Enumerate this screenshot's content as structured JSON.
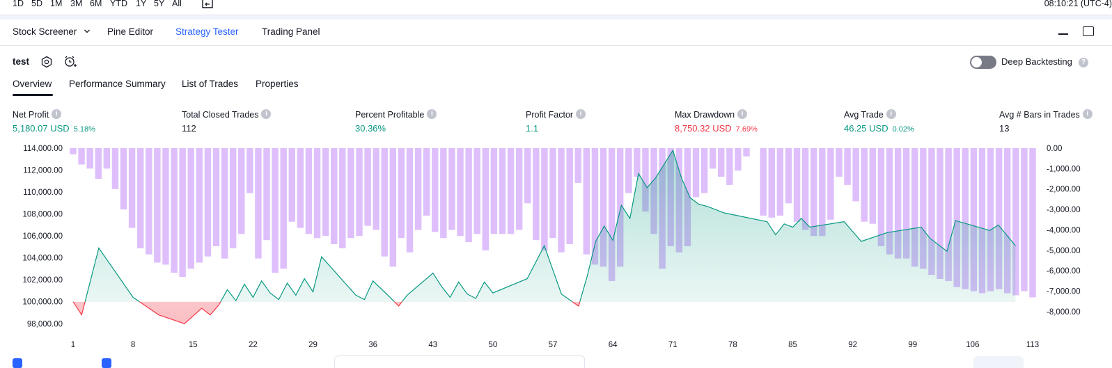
{
  "top_bar": {
    "ranges": [
      "1D",
      "5D",
      "1M",
      "3M",
      "6M",
      "YTD",
      "1Y",
      "5Y",
      "All"
    ],
    "clock": "08:10:21 (UTC-4)"
  },
  "panel_tabs": {
    "stock_screener": "Stock Screener",
    "pine_editor": "Pine Editor",
    "strategy_tester": "Strategy Tester",
    "trading_panel": "Trading Panel"
  },
  "strategy": {
    "name": "test",
    "deep_backtesting_label": "Deep Backtesting",
    "deep_backtesting_enabled": false
  },
  "sub_tabs": [
    "Overview",
    "Performance Summary",
    "List of Trades",
    "Properties"
  ],
  "metrics": [
    {
      "label": "Net Profit",
      "value": "5,180.07 USD",
      "pct": "5.18%",
      "color": "#089981"
    },
    {
      "label": "Total Closed Trades",
      "value": "112",
      "pct": "",
      "color": "#131722"
    },
    {
      "label": "Percent Profitable",
      "value": "30.36%",
      "pct": "",
      "color": "#089981"
    },
    {
      "label": "Profit Factor",
      "value": "1.1",
      "pct": "",
      "color": "#089981"
    },
    {
      "label": "Max Drawdown",
      "value": "8,750.32 USD",
      "pct": "7.69%",
      "color": "#f23645"
    },
    {
      "label": "Avg Trade",
      "value": "46.25 USD",
      "pct": "0.02%",
      "color": "#089981"
    },
    {
      "label": "Avg # Bars in Trades",
      "value": "13",
      "pct": "",
      "color": "#131722"
    }
  ],
  "colors": {
    "equity_up": "#089981",
    "equity_down": "#f23645",
    "drawdown_bar": "#d1a6fa",
    "accent": "#2962ff"
  },
  "chart_data": {
    "type": "line",
    "x_ticks": [
      "1",
      "8",
      "15",
      "22",
      "29",
      "36",
      "43",
      "50",
      "57",
      "64",
      "71",
      "78",
      "85",
      "92",
      "99",
      "106",
      "113"
    ],
    "left_axis": {
      "ticks": [
        "114,000.00",
        "112,000.00",
        "110,000.00",
        "108,000.00",
        "106,000.00",
        "104,000.00",
        "102,000.00",
        "100,000.00",
        "98,000.00"
      ],
      "ylim": [
        97700,
        114000
      ]
    },
    "right_axis": {
      "ticks": [
        "0.00",
        "-1,000.00",
        "-2,000.00",
        "-3,000.00",
        "-4,000.00",
        "-5,000.00",
        "-6,000.00",
        "-7,000.00",
        "-8,000.00"
      ],
      "ylim": [
        -8750,
        0
      ]
    },
    "xlim": [
      1,
      113
    ],
    "baseline": 100000,
    "equity": {
      "x": [
        1,
        2,
        4,
        8,
        11,
        14,
        16,
        17,
        18,
        19,
        20,
        21,
        22,
        23,
        24,
        25,
        26,
        27,
        28,
        29,
        30,
        34,
        35,
        36,
        38,
        39,
        40,
        43,
        44,
        45,
        46,
        47,
        48,
        49,
        50,
        54,
        56,
        58,
        60,
        61,
        62,
        63,
        64,
        65,
        66,
        67,
        68,
        69,
        71,
        72,
        73,
        74,
        75,
        77,
        82,
        83,
        84,
        85,
        86,
        87,
        91,
        93,
        96,
        100,
        101,
        103,
        104,
        108,
        109,
        111
      ],
      "y": [
        100000,
        98800,
        104900,
        100400,
        98800,
        98000,
        99400,
        98800,
        99700,
        101100,
        100100,
        101600,
        100400,
        101900,
        100800,
        100200,
        101700,
        100600,
        102100,
        100900,
        104100,
        100600,
        100200,
        101900,
        100400,
        99600,
        100600,
        102600,
        101400,
        100400,
        101800,
        100700,
        100300,
        101800,
        100800,
        102100,
        105100,
        100700,
        99600,
        102300,
        105500,
        106900,
        105600,
        108800,
        107600,
        111700,
        110400,
        111300,
        113800,
        111300,
        109500,
        108900,
        108700,
        108100,
        107300,
        106100,
        107100,
        106800,
        107600,
        106800,
        107300,
        105500,
        106300,
        106800,
        105800,
        104600,
        107400,
        106500,
        107000,
        105100,
        104800
      ]
    },
    "drawdown": [
      -300,
      -800,
      -1000,
      -1500,
      -1000,
      -2000,
      -3000,
      -3900,
      -4900,
      -5200,
      -5600,
      -5700,
      -6100,
      -6300,
      -5900,
      -5600,
      -5300,
      -4800,
      -5400,
      -4900,
      -4200,
      -2200,
      -5400,
      -4500,
      -6100,
      -5900,
      -3600,
      -3900,
      -4200,
      -4400,
      -4300,
      -4700,
      -4900,
      -4400,
      -4300,
      -3800,
      -4000,
      -5300,
      -5800,
      -4400,
      -5100,
      -4000,
      -3300,
      -4100,
      -4400,
      -4000,
      -4300,
      -4600,
      -4200,
      -5000,
      -4200,
      -4200,
      -4200,
      -4000,
      -2700,
      -4500,
      -5000,
      -4400,
      -5100,
      -4700,
      -1700,
      -5200,
      -5700,
      -5800,
      -6500,
      -5800,
      -2200,
      -1400,
      -3100,
      -4200,
      -5900,
      -4800,
      -5100,
      -4800,
      -2400,
      -2200,
      -1000,
      -1400,
      -1800,
      -1100,
      -400,
      0,
      -3300,
      -3400,
      -3300,
      -2700,
      -3600,
      -4000,
      -4300,
      -4300,
      -3500,
      -1400,
      -1800,
      -2600,
      -3600,
      -3700,
      -4800,
      -5200,
      -5400,
      -5400,
      -5800,
      -5900,
      -6200,
      -6400,
      -6500,
      -6800,
      -6900,
      -7000,
      -7100,
      -7000,
      -6900,
      -7100,
      -7200,
      -7000,
      -7300
    ]
  },
  "bottom": {}
}
